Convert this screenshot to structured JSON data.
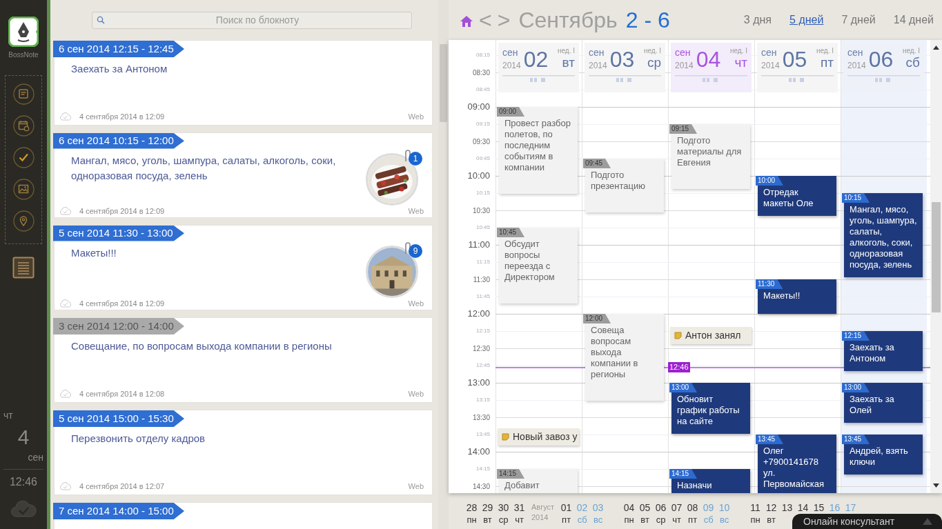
{
  "sidebar": {
    "logo_text": "BossNote",
    "date": {
      "weekday": "чт",
      "day": "4",
      "month": "сен",
      "time": "12:46"
    }
  },
  "search": {
    "placeholder": "Поиск по блокноту"
  },
  "notes": [
    {
      "tag": "6 сен 2014 12:15 - 12:45",
      "passed": false,
      "text": "Заехать за Антоном",
      "created": "4 сентября 2014 в 12:09",
      "source": "Web"
    },
    {
      "tag": "6 сен 2014 10:15 - 12:00",
      "passed": false,
      "text": "Мангал, мясо, уголь, шампура, салаты, алкоголь, соки, одноразовая посуда, зелень",
      "created": "4 сентября 2014 в 12:09",
      "source": "Web",
      "attachment": {
        "kind": "picture",
        "count": "1"
      }
    },
    {
      "tag": "5 сен 2014 11:30 - 13:00",
      "passed": false,
      "text": "Макеты!!!",
      "created": "4 сентября 2014 в 12:09",
      "source": "Web",
      "attachment": {
        "kind": "picture",
        "count": "9"
      }
    },
    {
      "tag": "3 сен 2014 12:00 - 14:00",
      "passed": true,
      "text": "Совещание, по вопросам выхода компании в регионы",
      "created": "4 сентября 2014 в 12:08",
      "source": "Web"
    },
    {
      "tag": "5 сен 2014 15:00 - 15:30",
      "passed": false,
      "text": "Перезвонить отделу кадров",
      "created": "4 сентября 2014 в 12:07",
      "source": "Web"
    },
    {
      "tag": "7 сен 2014 14:00 - 15:00",
      "passed": false
    }
  ],
  "calendar": {
    "nav": [
      "<",
      ">"
    ],
    "month": "Сентябрь",
    "range": "2 - 6",
    "views": [
      {
        "label": "3 дня",
        "selected": false
      },
      {
        "label": "5 дней",
        "selected": true
      },
      {
        "label": "7 дней",
        "selected": false
      },
      {
        "label": "14 дней",
        "selected": false
      }
    ],
    "time_labels": [
      "08:15",
      "08:30",
      "08:45",
      "09:00",
      "09:15",
      "09:30",
      "09:45",
      "10:00",
      "10:15",
      "10:30",
      "10:45",
      "11:00",
      "11:15",
      "11:30",
      "11:45",
      "12:00",
      "12:15",
      "12:30",
      "12:45",
      "13:00",
      "13:15",
      "13:30",
      "13:45",
      "14:00",
      "14:15",
      "14:30"
    ],
    "now": "12:46",
    "days": [
      {
        "month": "сен",
        "year": "2014",
        "day": "02",
        "week": "нед. I",
        "weekday": "вт",
        "today": false,
        "weekend": false,
        "events": [
          {
            "kind": "past",
            "time": "09:00",
            "title": "Провест разбор полетов, по последним событиям в компании"
          },
          {
            "kind": "past",
            "time": "10:45",
            "title": "Обсудит вопросы переезда с Директором"
          },
          {
            "kind": "note",
            "title": "Новый завоз у"
          },
          {
            "kind": "past",
            "time": "14:15",
            "title": "Добавит"
          }
        ]
      },
      {
        "month": "сен",
        "year": "2014",
        "day": "03",
        "week": "нед. I",
        "weekday": "ср",
        "today": false,
        "weekend": false,
        "events": [
          {
            "kind": "past",
            "time": "09:45",
            "title": "Подгото презентацию"
          },
          {
            "kind": "past",
            "time": "12:00",
            "title": "Совеща вопросам выхода компании в регионы"
          }
        ]
      },
      {
        "month": "сен",
        "year": "2014",
        "day": "04",
        "week": "нед. I",
        "weekday": "чт",
        "today": true,
        "weekend": false,
        "events": [
          {
            "kind": "past",
            "time": "09:15",
            "title": "Подгото материалы для Евгения"
          },
          {
            "kind": "note",
            "title": "Антон занял"
          },
          {
            "kind": "planned",
            "time": "13:00",
            "title": "Обновит график работы на сайте"
          },
          {
            "kind": "planned",
            "time": "14:15",
            "title": "Назначи"
          }
        ]
      },
      {
        "month": "сен",
        "year": "2014",
        "day": "05",
        "week": "нед. I",
        "weekday": "пт",
        "today": false,
        "weekend": false,
        "events": [
          {
            "kind": "planned",
            "time": "10:00",
            "title": "Отредак макеты Оле"
          },
          {
            "kind": "planned",
            "time": "11:30",
            "title": "Макеты!!"
          },
          {
            "kind": "planned",
            "time": "13:45",
            "title": "Олег +7900141678 ул. Первомайская"
          }
        ]
      },
      {
        "month": "сен",
        "year": "2014",
        "day": "06",
        "week": "нед. I",
        "weekday": "сб",
        "today": false,
        "weekend": true,
        "events": [
          {
            "kind": "planned",
            "time": "10:15",
            "title": "Мангал, мясо, уголь, шампура, салаты, алкоголь, соки, одноразовая посуда, зелень"
          },
          {
            "kind": "planned",
            "time": "12:15",
            "title": "Заехать за Антоном"
          },
          {
            "kind": "planned",
            "time": "13:00",
            "title": "Заехать за Олей"
          },
          {
            "kind": "planned",
            "time": "13:45",
            "title": "Андрей, взять ключи"
          }
        ]
      }
    ]
  },
  "mini_calendar": {
    "weeks": [
      {
        "items": [
          {
            "kind": "day",
            "number": "28",
            "weekday": "пн",
            "weekend": false
          },
          {
            "kind": "day",
            "number": "29",
            "weekday": "вт",
            "weekend": false
          },
          {
            "kind": "day",
            "number": "30",
            "weekday": "ср",
            "weekend": false
          },
          {
            "kind": "day",
            "number": "31",
            "weekday": "чт",
            "weekend": false
          },
          {
            "kind": "month",
            "name": "Август",
            "year": "2014"
          },
          {
            "kind": "day",
            "number": "01",
            "weekday": "пт",
            "weekend": false
          },
          {
            "kind": "day",
            "number": "02",
            "weekday": "сб",
            "weekend": true
          },
          {
            "kind": "day",
            "number": "03",
            "weekday": "вс",
            "weekend": true
          }
        ]
      },
      {
        "items": [
          {
            "kind": "day",
            "number": "04",
            "weekday": "пн",
            "weekend": false
          },
          {
            "kind": "day",
            "number": "05",
            "weekday": "вт",
            "weekend": false
          },
          {
            "kind": "day",
            "number": "06",
            "weekday": "ср",
            "weekend": false
          },
          {
            "kind": "day",
            "number": "07",
            "weekday": "чт",
            "weekend": false
          },
          {
            "kind": "day",
            "number": "08",
            "weekday": "пт",
            "weekend": false
          },
          {
            "kind": "day",
            "number": "09",
            "weekday": "сб",
            "weekend": true
          },
          {
            "kind": "day",
            "number": "10",
            "weekday": "вс",
            "weekend": true
          }
        ]
      },
      {
        "items": [
          {
            "kind": "day",
            "number": "11",
            "weekday": "пн",
            "weekend": false
          },
          {
            "kind": "day",
            "number": "12",
            "weekday": "вт",
            "weekend": false
          },
          {
            "kind": "day",
            "number": "13",
            "weekend": false
          },
          {
            "kind": "day",
            "number": "14",
            "weekend": false
          },
          {
            "kind": "day",
            "number": "15",
            "weekend": false
          },
          {
            "kind": "day",
            "number": "16",
            "weekend": true
          },
          {
            "kind": "day",
            "number": "17",
            "weekend": true
          }
        ]
      }
    ]
  },
  "chat": {
    "label": "Онлайн консультант"
  }
}
